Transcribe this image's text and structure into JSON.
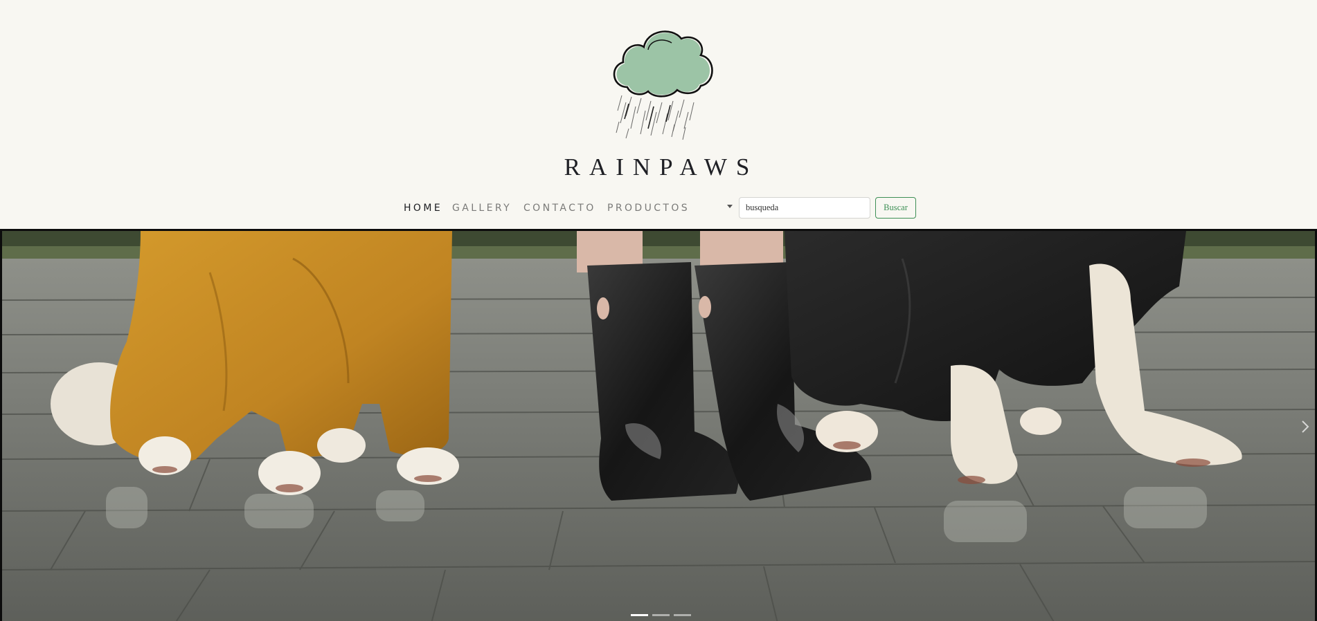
{
  "brand": {
    "name": "RAINPAWS",
    "logo_icon": "rain-cloud-icon",
    "logo_color": "#9cc4a6"
  },
  "nav": {
    "items": [
      {
        "label": "HOME",
        "active": true
      },
      {
        "label": "GALLERY",
        "active": false
      },
      {
        "label": "CONTACTO",
        "active": false
      },
      {
        "label": "PRODUCTOS",
        "active": false
      }
    ],
    "dropdown_icon": "caret-down-icon"
  },
  "search": {
    "value": "busqueda",
    "button_label": "Buscar",
    "accent_color": "#3d8f55"
  },
  "hero": {
    "image_subject": "dogs in raincoats and person in black rain boots on wet pavement",
    "indicators": [
      {
        "active": true
      },
      {
        "active": false
      },
      {
        "active": false
      }
    ],
    "next_icon": "chevron-right-icon"
  },
  "colors": {
    "background": "#f8f7f2",
    "text_dark": "#1f2025",
    "nav_inactive": "#7a7a78"
  }
}
